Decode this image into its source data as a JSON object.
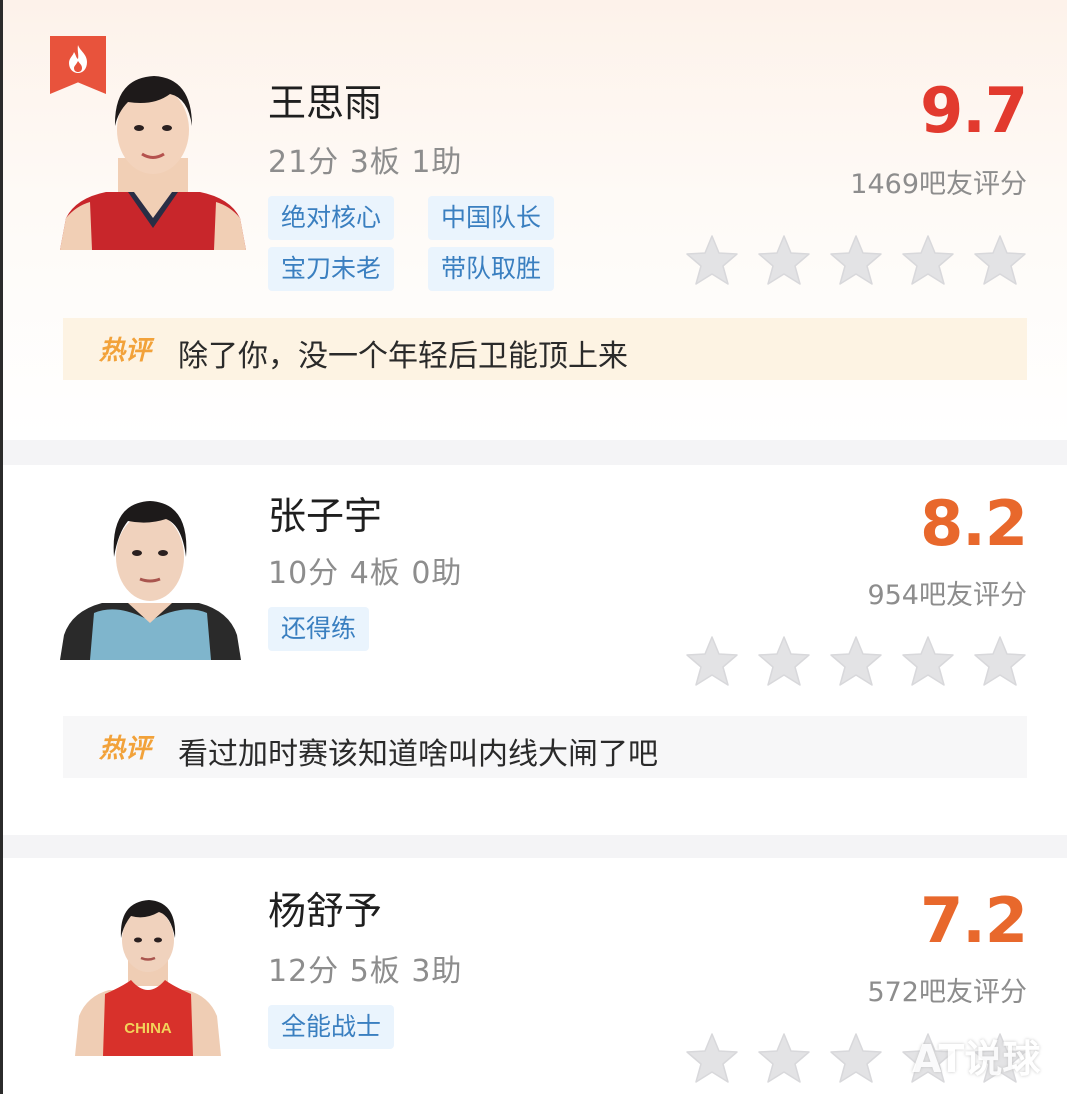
{
  "players": [
    {
      "name": "王思雨",
      "stats": "21分 3板 1助",
      "tags": [
        "绝对核心",
        "中国队长",
        "宝刀未老",
        "带队取胜"
      ],
      "score": "9.7",
      "score_color": "#e23a2e",
      "raters": "1469吧友评分",
      "jersey_color": "#c8262b",
      "hot_comment_label": "热评",
      "hot_comment": "除了你，没一个年轻后卫能顶上来",
      "featured_icon": "flame-icon"
    },
    {
      "name": "张子宇",
      "stats": "10分 4板 0助",
      "tags": [
        "还得练"
      ],
      "score": "8.2",
      "score_color": "#e8682c",
      "raters": "954吧友评分",
      "jersey_color": "#7fb5cc",
      "hot_comment_label": "热评",
      "hot_comment": "看过加时赛该知道啥叫内线大闸了吧"
    },
    {
      "name": "杨舒予",
      "stats": "12分 5板 3助",
      "tags": [
        "全能战士"
      ],
      "score": "7.2",
      "score_color": "#e8682c",
      "raters": "572吧友评分",
      "jersey_color": "#d8312b",
      "jersey_text": "CHINA"
    }
  ],
  "star_count": 5,
  "star_color": "#e3e3e5",
  "watermark": "AT说球"
}
